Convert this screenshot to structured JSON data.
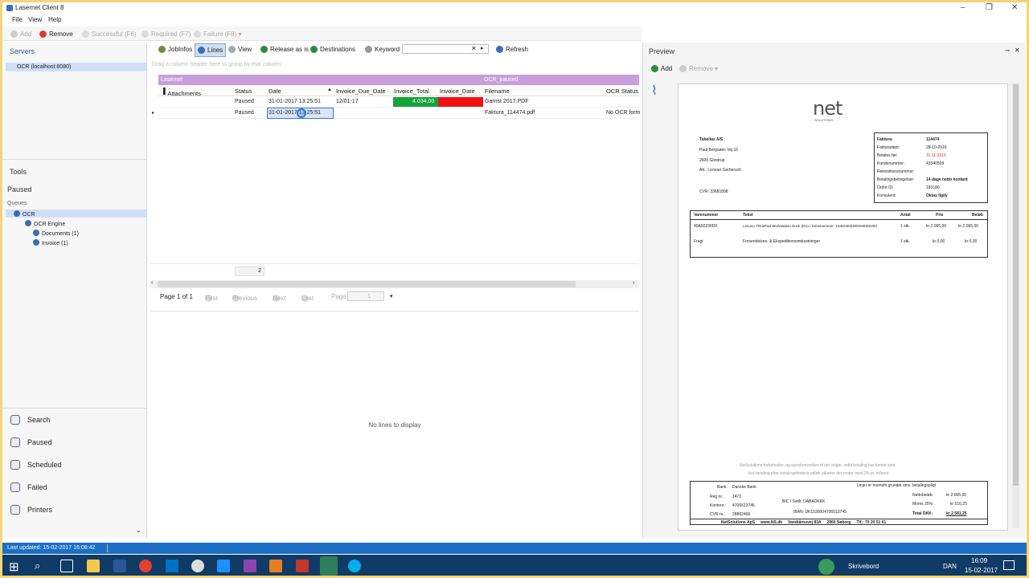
{
  "window": {
    "title": "Lasernet Client 8"
  },
  "menu": [
    "File",
    "View",
    "Help"
  ],
  "toolbar": {
    "add": "Add",
    "remove": "Remove",
    "successful": "Successful (F6)",
    "required": "Required (F7)",
    "failure": "Failure (F8)"
  },
  "servers": {
    "title": "Servers",
    "item": "OCR (localhost:8080)"
  },
  "tools": {
    "title": "Tools",
    "paused": "Paused",
    "queues": "Queues",
    "tree": [
      "OCR",
      "OCR Engine",
      "Documents (1)",
      "Invoice (1)"
    ]
  },
  "nav": [
    "Search",
    "Paused",
    "Scheduled",
    "Failed",
    "Printers"
  ],
  "grid_toolbar": {
    "jobinfos": "JobInfos",
    "lines": "Lines",
    "view": "View",
    "release": "Release as is",
    "destinations": "Destinations",
    "keyword": "Keyword",
    "refresh": "Refresh"
  },
  "group_hint": "Drag a column header here to group by that column",
  "bands": {
    "left": "Lasernet",
    "right": "OCR_paused"
  },
  "columns": [
    "Attachments",
    "Status",
    "Date",
    "Invoice_Due_Date",
    "Invoice_Total",
    "Invoice_Date",
    "Filename",
    "OCR Status"
  ],
  "rows": [
    {
      "status": "Paused",
      "date": "31-01-2017 13:25:51",
      "due": "12/01-17",
      "total": "4.034,00",
      "filename": "Garnst 2017.PDF",
      "ocr": ""
    },
    {
      "status": "Paused",
      "date": "31-01-2017 13:25:51",
      "due": "",
      "total": "",
      "filename": "Faktura_114474.pdf",
      "ocr": "No OCR form"
    }
  ],
  "row_count": "2",
  "pager": {
    "label": "Page 1 of 1",
    "first": "First",
    "previous": "Previous",
    "next": "Next",
    "last": "Last",
    "page": "Page",
    "value": "1"
  },
  "empty": "No lines to display",
  "preview": {
    "title": "Preview",
    "add": "Add",
    "remove": "Remove"
  },
  "invoice": {
    "logo": "net",
    "logo_sub": "SOLUTIONS",
    "customer": [
      "Tabellas A/S",
      "Paul Bergsøes Vej 16",
      "2600 Glostrup",
      "Att.: Lennart Gerbersch",
      "CVR: 33681898"
    ],
    "meta_labels": [
      "Faktura:",
      "Fakturadato:",
      "Betales før:",
      "Kundenummer:",
      "Rekvisitionsnummer:",
      "Betalingsbetingelser:",
      "Ordre ID:",
      "Konsulent:"
    ],
    "meta_values": [
      "114474",
      "28-10-2016",
      "11-11-2016",
      "43340509",
      "",
      "14 dage netto kontant",
      "183180",
      "Oktay Ilgily"
    ],
    "line_headers": [
      "Varenummer",
      "Tekst",
      "Antal",
      "Pris",
      "Beløb"
    ],
    "lines": [
      {
        "nr": "40A50230DK",
        "text": "Lenovo ThinkPad Workstation Dock (EU) / Serienummer: 1S40A50230DKM0D0263",
        "qty": "1 stk.",
        "price": "kr 2.065,00",
        "amount": "kr 2.065,00"
      },
      {
        "nr": "Fragt",
        "text": "Forsendelses- & Ekspeditionsomkostninger",
        "qty": "1 stk.",
        "price": "kr 0,00",
        "amount": "kr 0,00"
      }
    ],
    "footnote1": "NetSolutions forbeholder sig ejendomsretten til det solgte, indtil betaling har fundet sted.",
    "footnote2": "Ved betaling efter betalingsfristens udløb påløber der renter med 2% pr. måned.",
    "bank_labels": [
      "Bank:",
      "Reg nr.:",
      "Kontonr.:",
      "CVR nr.:"
    ],
    "bank_values": [
      "Danske Bank",
      "1471",
      "4706513745",
      "28862466"
    ],
    "bic": "BIC / Swift: DABADKKK",
    "iban": "IBAN: DK1530004706513745",
    "notice": "Linjer er momsfri grundet omv. betalingspligt",
    "totals_labels": [
      "Nettobeløb:",
      "Moms 25%:",
      "Total DKK:"
    ],
    "totals_values": [
      "kr 2.065,00",
      "kr 516,25",
      "kr 2.581,25"
    ],
    "company_line": "NetSolutions ApS     www.NS.dk     Vandtårnsvej 83A     2860 Søborg     Tlf.: 70 20 51 61"
  },
  "status": {
    "last_updated": "Last updated: 15-02-2017 16:08:42"
  },
  "taskbar": {
    "lang": "DAN",
    "desktop": "Skrivebord",
    "time": "16:09",
    "date": "15-02-2017"
  },
  "colors": {
    "band": "#c89fd8",
    "green": "#14a23a",
    "red": "#ee1111",
    "status": "#1c6fc2",
    "taskbar": "#0f3b66"
  }
}
